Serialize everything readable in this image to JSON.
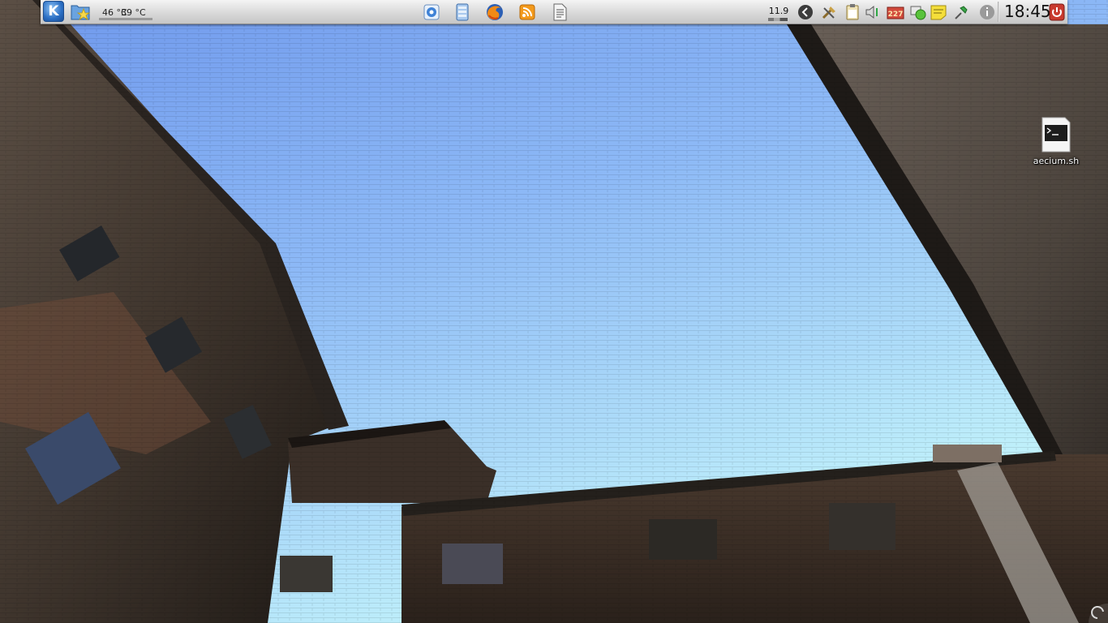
{
  "panel": {
    "kickoff_label": "K",
    "temperature_1": "46 °C",
    "temperature_2": "39 °C",
    "cpu_value": "11.9",
    "clock": "18:45"
  },
  "launchers": [
    {
      "name": "system-settings",
      "icon": "settings-icon"
    },
    {
      "name": "file-manager",
      "icon": "storage-icon"
    },
    {
      "name": "firefox",
      "icon": "firefox-icon"
    },
    {
      "name": "feed-reader",
      "icon": "rss-icon"
    },
    {
      "name": "text-editor",
      "icon": "document-icon"
    }
  ],
  "tray": {
    "badge_count": "227",
    "items": [
      "arrow-left-icon",
      "tools-icon",
      "clipboard-icon",
      "volume-icon",
      "mail-icon",
      "network-icon",
      "notes-icon",
      "pin-icon",
      "info-icon"
    ]
  },
  "desktop": {
    "icon_label": "aecium.sh",
    "icon_type": "terminal-script-icon"
  },
  "colors": {
    "sky_top": "#6f9ff0",
    "sky_bottom": "#b9f0fb",
    "panel": "#dcdcdc"
  }
}
